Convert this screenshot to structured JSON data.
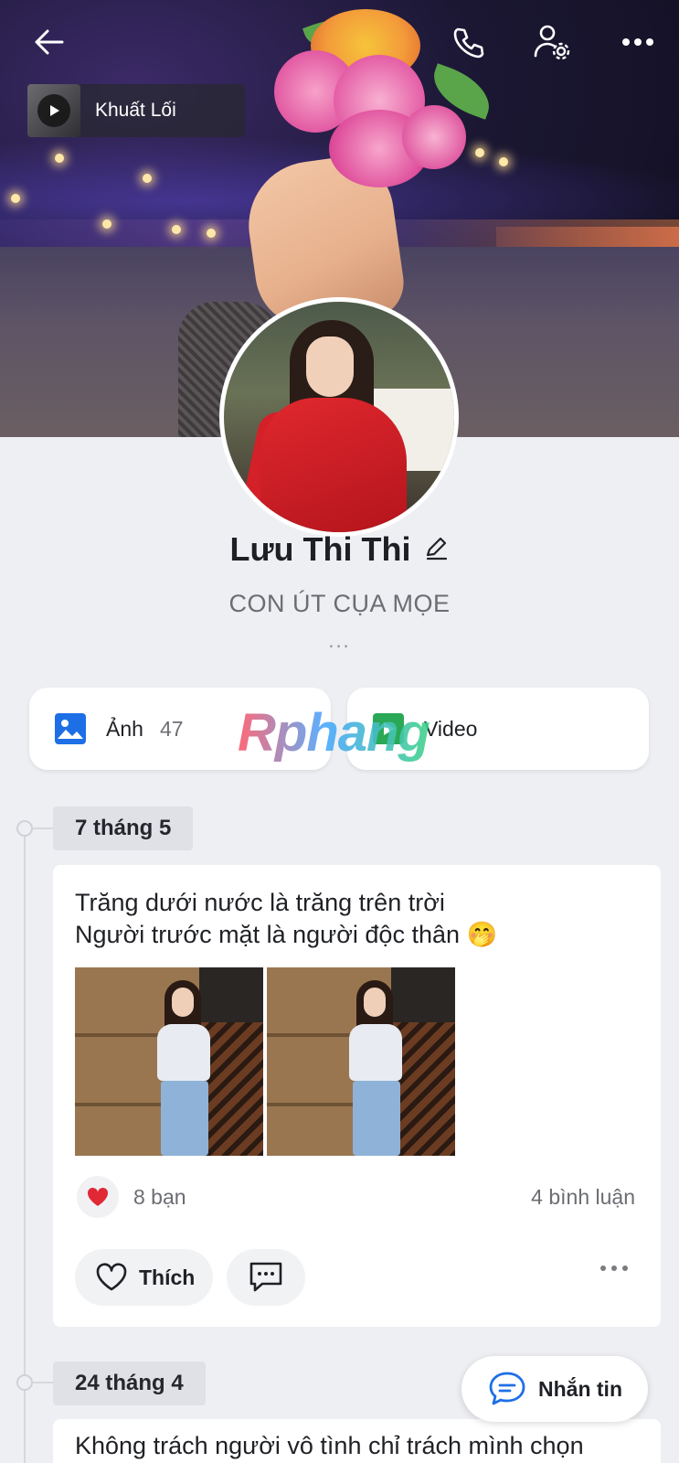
{
  "cover": {
    "music_title": "Khuất Lối"
  },
  "profile": {
    "name": "Lưu Thi Thi",
    "bio": "CON ÚT CỤA MỌE",
    "more": "..."
  },
  "media": {
    "photos_label": "Ảnh",
    "photos_count": "47",
    "video_label": "Video"
  },
  "watermark": "Rphang",
  "timeline": [
    {
      "date": "7 tháng 5",
      "text_line1": "Trăng dưới nước là trăng trên trời",
      "text_line2": "Người trước mặt là người độc thân 🤭",
      "reactions": "8 bạn",
      "comments": "4 bình luận",
      "like_label": "Thích"
    },
    {
      "date": "24 tháng 4",
      "text_line1": "Không trách người vô tình chỉ trách mình chọn"
    }
  ],
  "message_button": "Nhắn tin",
  "colors": {
    "background": "#eeeff3",
    "accent_blue": "#1e6fe6",
    "heart_red": "#e02935"
  },
  "icons": [
    "back-arrow-icon",
    "phone-icon",
    "user-settings-icon",
    "more-icon",
    "play-icon",
    "edit-icon",
    "image-icon",
    "video-icon",
    "heart-icon",
    "comment-icon",
    "chat-icon"
  ]
}
